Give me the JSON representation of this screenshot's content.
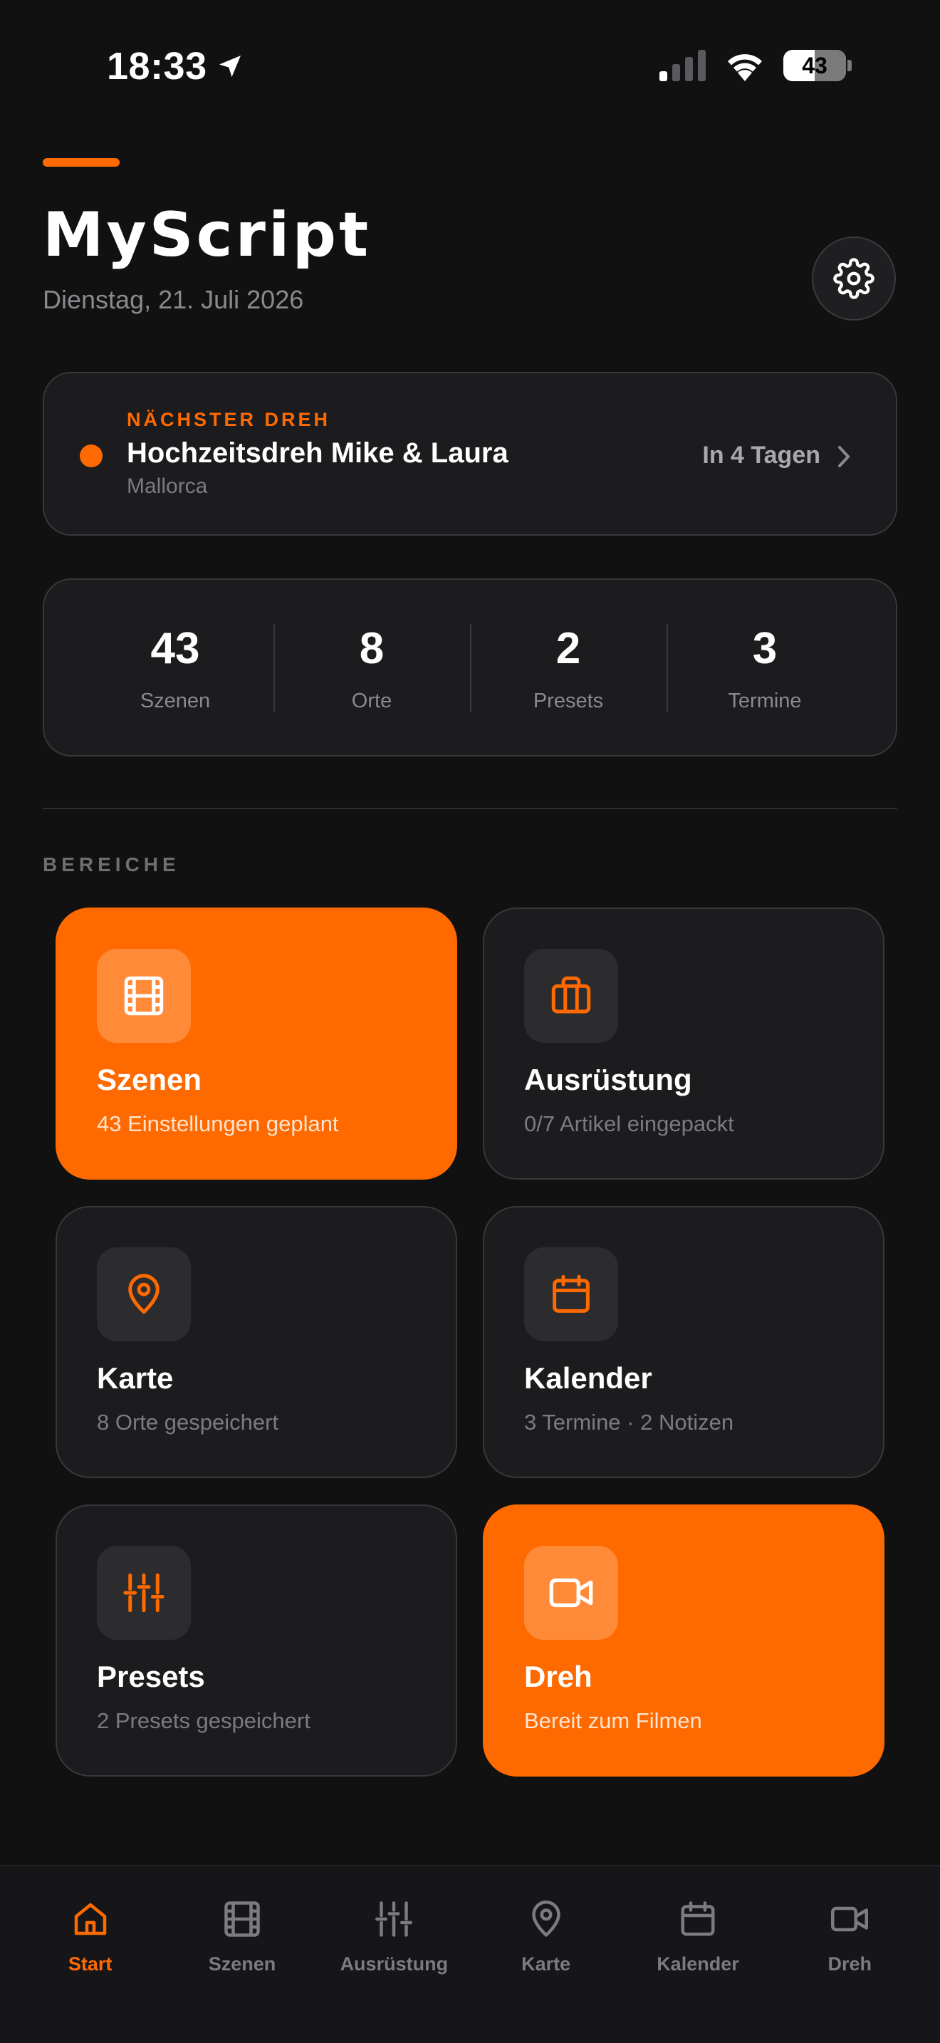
{
  "status_bar": {
    "time": "18:33",
    "battery": "43",
    "icons": [
      "location-arrow-icon",
      "cellular-signal-icon",
      "wifi-icon",
      "battery-icon"
    ]
  },
  "header": {
    "title": "MyScript",
    "date": "Dienstag, 21. Juli 2026",
    "settings_icon": "gear-icon"
  },
  "next_shoot": {
    "kicker": "NÄCHSTER DREH",
    "title": "Hochzeitsdreh Mike & Laura",
    "location": "Mallorca",
    "when": "In 4 Tagen"
  },
  "stats": [
    {
      "value": "43",
      "label": "Szenen"
    },
    {
      "value": "8",
      "label": "Orte"
    },
    {
      "value": "2",
      "label": "Presets"
    },
    {
      "value": "3",
      "label": "Termine"
    }
  ],
  "section_label": "BEREICHE",
  "tiles": [
    {
      "title": "Szenen",
      "subtitle": "43 Einstellungen geplant",
      "icon": "film-icon",
      "accent": true
    },
    {
      "title": "Ausrüstung",
      "subtitle": "0/7 Artikel eingepackt",
      "icon": "briefcase-icon",
      "accent": false
    },
    {
      "title": "Karte",
      "subtitle": "8 Orte gespeichert",
      "icon": "map-pin-icon",
      "accent": false
    },
    {
      "title": "Kalender",
      "subtitle": "3 Termine · 2 Notizen",
      "icon": "calendar-icon",
      "accent": false
    },
    {
      "title": "Presets",
      "subtitle": "2 Presets gespeichert",
      "icon": "sliders-icon",
      "accent": false
    },
    {
      "title": "Dreh",
      "subtitle": "Bereit zum Filmen",
      "icon": "video-camera-icon",
      "accent": true
    }
  ],
  "tab_bar": [
    {
      "label": "Start",
      "icon": "home-icon",
      "active": true
    },
    {
      "label": "Szenen",
      "icon": "film-icon",
      "active": false
    },
    {
      "label": "Ausrüstung",
      "icon": "sliders-icon",
      "active": false
    },
    {
      "label": "Karte",
      "icon": "map-pin-icon",
      "active": false
    },
    {
      "label": "Kalender",
      "icon": "calendar-icon",
      "active": false
    },
    {
      "label": "Dreh",
      "icon": "video-camera-icon",
      "active": false
    }
  ],
  "colors": {
    "accent": "#ff6a00",
    "background": "#111111",
    "card": "#1c1c1e",
    "muted_text": "#8a8a8e"
  }
}
